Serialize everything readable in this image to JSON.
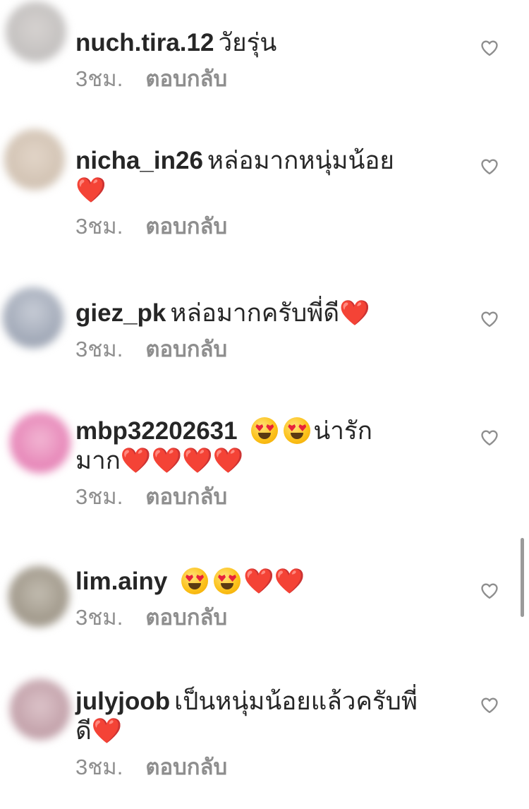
{
  "comments": [
    {
      "username": "nuch.tira.12",
      "text": "วัยรุ่น",
      "text2": "",
      "time": "3ชม.",
      "reply": "ตอบกลับ",
      "avatar_colors": [
        "#b9b7b6",
        "#d6d2d0"
      ]
    },
    {
      "username": "nicha_in26",
      "text": "หล่อมากหนุ่มน้อย",
      "text2": "❤️",
      "time": "3ชม.",
      "reply": "ตอบกลับ",
      "avatar_colors": [
        "#c9b9a8",
        "#e2d5c8"
      ]
    },
    {
      "username": "giez_pk",
      "text": "หล่อมากครับพี่ดี",
      "text2": "❤️",
      "time": "3ชม.",
      "reply": "ตอบกลับ",
      "avatar_colors": [
        "#8c95a6",
        "#c7ccd6"
      ]
    },
    {
      "username": "mbp32202631",
      "text": "น่ารัก",
      "text2": "มาก",
      "time": "3ชม.",
      "reply": "ตอบกลับ",
      "avatar_colors": [
        "#e06aa8",
        "#f2b6d3"
      ]
    },
    {
      "username": "lim.ainy",
      "text": "",
      "text2": "",
      "time": "3ชม.",
      "reply": "ตอบกลับ",
      "avatar_colors": [
        "#8e8576",
        "#c2bcb0"
      ]
    },
    {
      "username": "julyjoob",
      "text": "เป็นหนุ่มน้อยแล้วครับพี่",
      "text2": "ดี",
      "time": "3ชม.",
      "reply": "ตอบกลับ",
      "avatar_colors": [
        "#b48e98",
        "#dcc3c9"
      ]
    }
  ],
  "icons": {
    "like": "heart-outline-icon",
    "heart_emoji": "red-heart-emoji",
    "face_emoji": "heart-eyes-emoji"
  },
  "colors": {
    "text": "#262626",
    "meta": "#8e8e8e",
    "heart": "#e0203a"
  }
}
